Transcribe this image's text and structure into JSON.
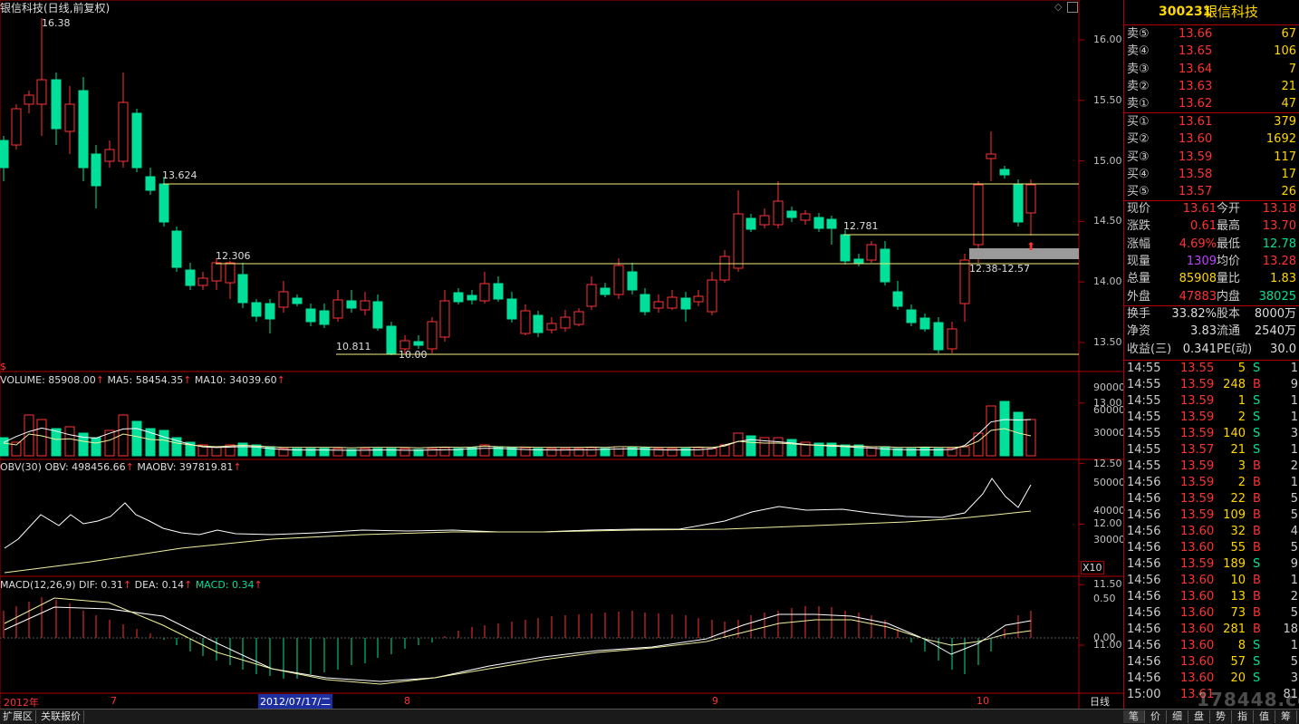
{
  "header": {
    "title": "银信科技(日线,前复权)",
    "code": "300231",
    "name": "银信科技"
  },
  "price_panel": {
    "high_marker": "16.38",
    "low_marker": "10.00",
    "level_labels": [
      "13.624",
      "12.306",
      "10.811",
      "12.781"
    ],
    "range_label": "12.38-12.57",
    "y_ticks": [
      "16.00",
      "15.50",
      "15.00",
      "14.50",
      "14.00",
      "13.50",
      "13.00",
      "12.50",
      "12.00",
      "11.50",
      "11.00"
    ],
    "dollar": "$"
  },
  "volume_panel": {
    "label": "VOLUME: 85908.00",
    "ma5": "MA5: 58454.35",
    "ma10": "MA10: 34039.60",
    "y_ticks": [
      "90000",
      "60000",
      "30000"
    ]
  },
  "obv_panel": {
    "label": "OBV(30) OBV: 498456.66",
    "maobv": "MAOBV: 397819.81",
    "y_ticks": [
      "50000",
      "40000",
      "30000"
    ],
    "scale": "X10"
  },
  "macd_panel": {
    "label": "MACD(12,26,9) DIF: 0.31",
    "dea": "DEA: 0.14",
    "macd": "MACD: 0.34",
    "y_ticks": [
      "0.50",
      "0.00"
    ]
  },
  "time_axis": {
    "labels": [
      "2012年",
      "7",
      "8",
      "9",
      "10"
    ],
    "cursor": "2012/07/17/二",
    "period": "日线"
  },
  "order_book": {
    "asks": [
      {
        "label": "卖⑤",
        "price": "13.66",
        "vol": "67"
      },
      {
        "label": "卖④",
        "price": "13.65",
        "vol": "106"
      },
      {
        "label": "卖③",
        "price": "13.64",
        "vol": "7"
      },
      {
        "label": "卖②",
        "price": "13.63",
        "vol": "21"
      },
      {
        "label": "卖①",
        "price": "13.62",
        "vol": "47"
      }
    ],
    "bids": [
      {
        "label": "买①",
        "price": "13.61",
        "vol": "379"
      },
      {
        "label": "买②",
        "price": "13.60",
        "vol": "1692"
      },
      {
        "label": "买③",
        "price": "13.59",
        "vol": "117"
      },
      {
        "label": "买④",
        "price": "13.58",
        "vol": "17"
      },
      {
        "label": "买⑤",
        "price": "13.57",
        "vol": "26"
      }
    ]
  },
  "quote": [
    {
      "k1": "现价",
      "v1": "13.61",
      "k2": "今开",
      "v2": "13.18"
    },
    {
      "k1": "涨跌",
      "v1": "0.61",
      "k2": "最高",
      "v2": "13.70"
    },
    {
      "k1": "涨幅",
      "v1": "4.69%",
      "k2": "最低",
      "v2": "12.78"
    },
    {
      "k1": "现量",
      "v1": "1309",
      "k2": "均价",
      "v2": "13.28"
    },
    {
      "k1": "总量",
      "v1": "85908",
      "k2": "量比",
      "v2": "1.83"
    },
    {
      "k1": "外盘",
      "v1": "47883",
      "k2": "内盘",
      "v2": "38025"
    }
  ],
  "fundamentals": [
    {
      "k1": "换手",
      "v1": "33.82%",
      "k2": "股本",
      "v2": "8000万"
    },
    {
      "k1": "净资",
      "v1": "3.83",
      "k2": "流通",
      "v2": "2540万"
    },
    {
      "k1": "收益(三)",
      "v1": "0.341",
      "k2": "PE(动)",
      "v2": "30.0"
    }
  ],
  "ticks": [
    {
      "t": "14:55",
      "p": "13.55",
      "v": "5",
      "d": "S",
      "n": "1"
    },
    {
      "t": "14:55",
      "p": "13.59",
      "v": "248",
      "d": "B",
      "n": "9"
    },
    {
      "t": "14:55",
      "p": "13.59",
      "v": "1",
      "d": "S",
      "n": "1"
    },
    {
      "t": "14:55",
      "p": "13.59",
      "v": "2",
      "d": "S",
      "n": "1"
    },
    {
      "t": "14:55",
      "p": "13.59",
      "v": "140",
      "d": "S",
      "n": "3"
    },
    {
      "t": "14:55",
      "p": "13.57",
      "v": "21",
      "d": "S",
      "n": "1"
    },
    {
      "t": "14:55",
      "p": "13.59",
      "v": "3",
      "d": "B",
      "n": "2"
    },
    {
      "t": "14:56",
      "p": "13.59",
      "v": "2",
      "d": "B",
      "n": "1"
    },
    {
      "t": "14:56",
      "p": "13.59",
      "v": "22",
      "d": "B",
      "n": "5"
    },
    {
      "t": "14:56",
      "p": "13.59",
      "v": "109",
      "d": "B",
      "n": "5"
    },
    {
      "t": "14:56",
      "p": "13.60",
      "v": "32",
      "d": "B",
      "n": "4"
    },
    {
      "t": "14:56",
      "p": "13.60",
      "v": "55",
      "d": "B",
      "n": "5"
    },
    {
      "t": "14:56",
      "p": "13.59",
      "v": "189",
      "d": "S",
      "n": "9"
    },
    {
      "t": "14:56",
      "p": "13.60",
      "v": "10",
      "d": "B",
      "n": "1"
    },
    {
      "t": "14:56",
      "p": "13.60",
      "v": "13",
      "d": "B",
      "n": "2"
    },
    {
      "t": "14:56",
      "p": "13.60",
      "v": "73",
      "d": "B",
      "n": "5"
    },
    {
      "t": "14:56",
      "p": "13.60",
      "v": "281",
      "d": "B",
      "n": "18"
    },
    {
      "t": "14:56",
      "p": "13.60",
      "v": "8",
      "d": "S",
      "n": "1"
    },
    {
      "t": "14:56",
      "p": "13.60",
      "v": "57",
      "d": "S",
      "n": "5"
    },
    {
      "t": "14:56",
      "p": "13.60",
      "v": "20",
      "d": "S",
      "n": "3"
    },
    {
      "t": "15:00",
      "p": "13.61",
      "v": "",
      "d": "",
      "n": "81"
    }
  ],
  "bottom_tabs": [
    "扩展区",
    "关联报价"
  ],
  "side_tabs": [
    "笔",
    "价",
    "细",
    "盘",
    "势",
    "指",
    "值",
    "筹"
  ],
  "colors": {
    "up": "#ff3232",
    "down": "#00e09a",
    "ma": "#f0f0a0",
    "axis": "#b00000",
    "text": "#c0c0c0"
  }
}
